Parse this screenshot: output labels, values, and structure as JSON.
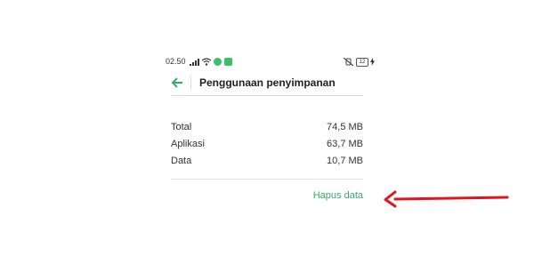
{
  "status_bar": {
    "time": "02.50",
    "battery": "12"
  },
  "header": {
    "title": "Penggunaan penyimpanan"
  },
  "storage": {
    "items": [
      {
        "label": "Total",
        "value": "74,5 MB"
      },
      {
        "label": "Aplikasi",
        "value": "63,7 MB"
      },
      {
        "label": "Data",
        "value": "10,7 MB"
      }
    ]
  },
  "actions": {
    "clear_data_label": "Hapus data"
  },
  "colors": {
    "accent": "#3aa86b",
    "arrow": "#e5141b"
  },
  "icons": {
    "back": "arrow-left-icon",
    "signal": "signal-icon",
    "wifi": "wifi-icon",
    "mute": "vibrate-off-icon",
    "charge": "charging-icon"
  }
}
